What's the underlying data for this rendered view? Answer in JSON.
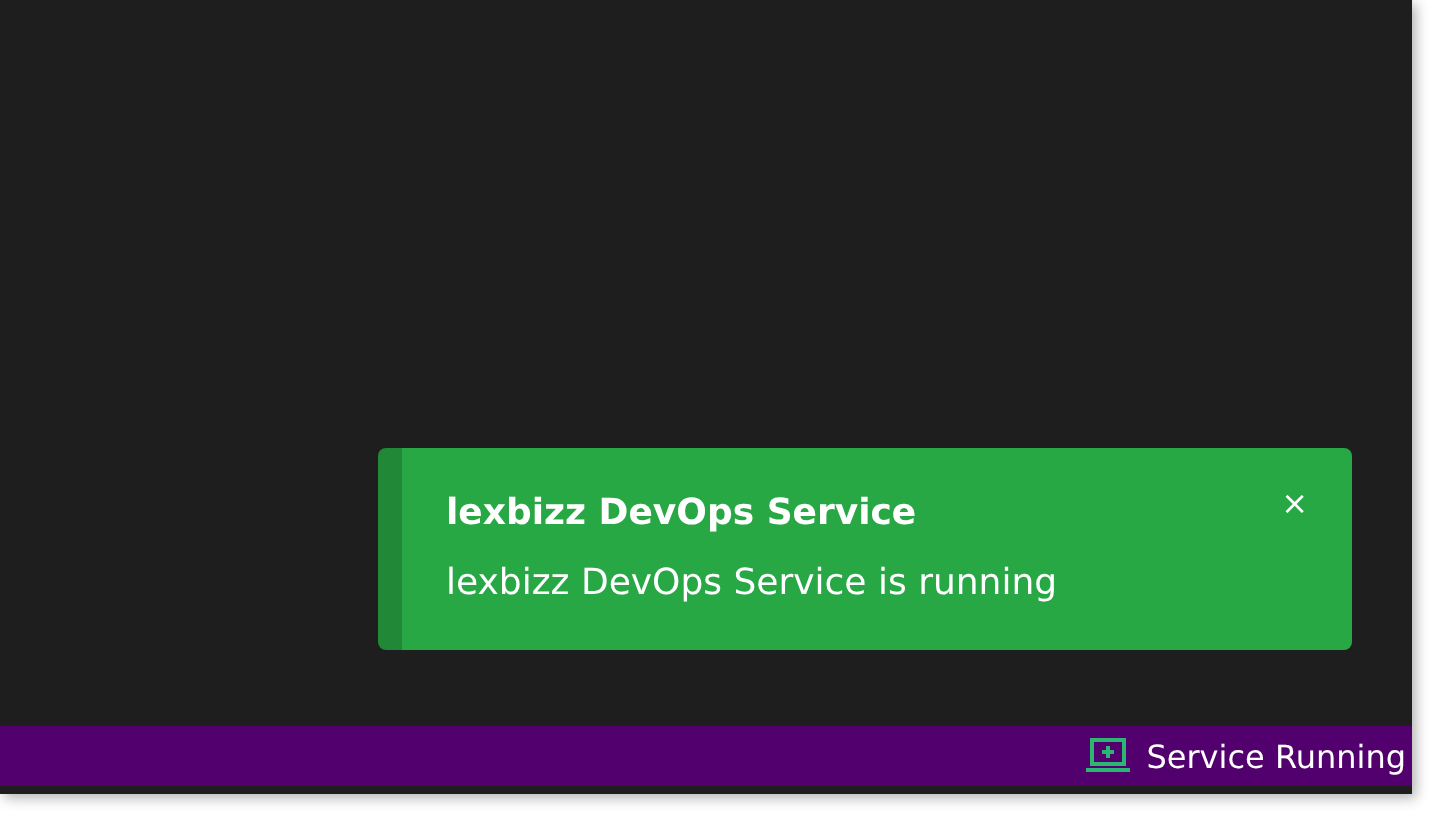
{
  "notification": {
    "title": "lexbizz DevOps Service",
    "message": "lexbizz DevOps Service is running",
    "close": "×"
  },
  "status_bar": {
    "text": "Service Running"
  }
}
